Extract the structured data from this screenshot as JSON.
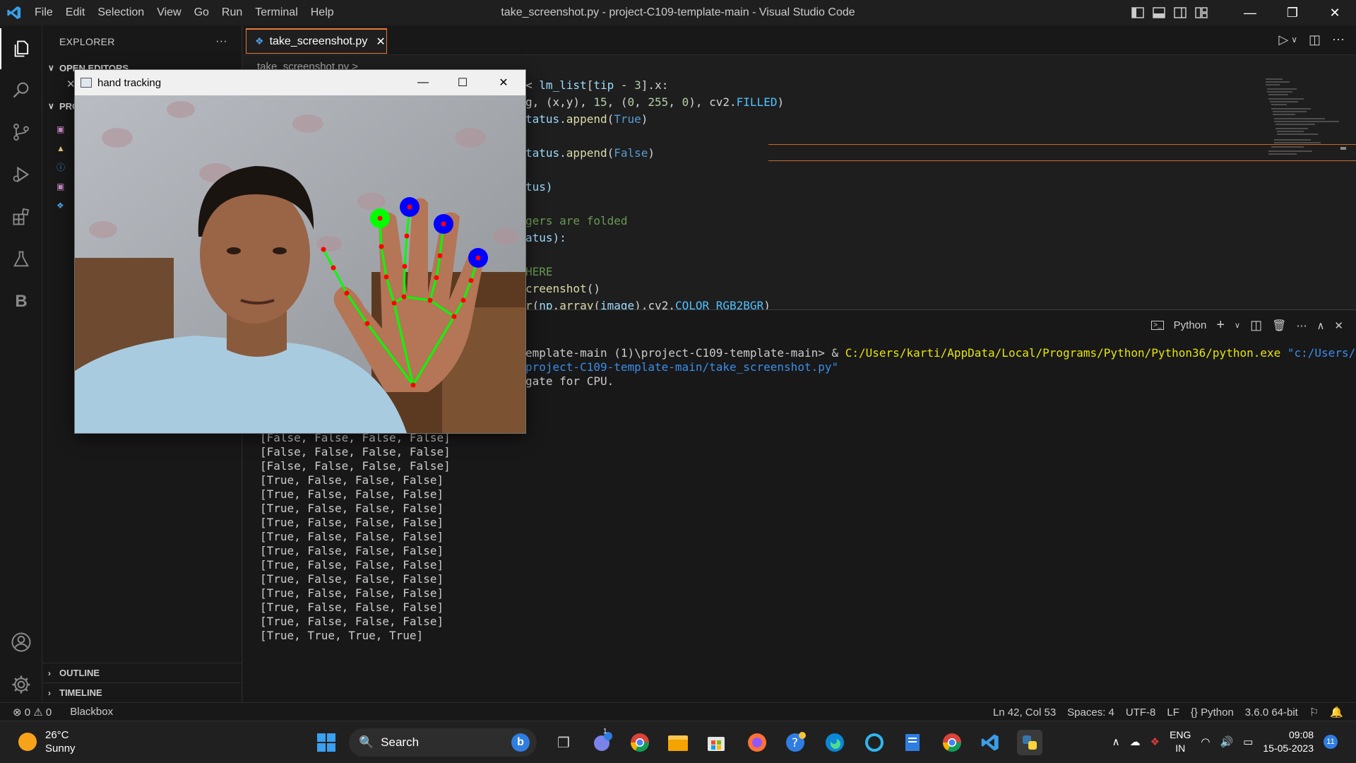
{
  "window": {
    "title": "take_screenshot.py - project-C109-template-main - Visual Studio Code",
    "menu": [
      "File",
      "Edit",
      "Selection",
      "View",
      "Go",
      "Run",
      "Terminal",
      "Help"
    ]
  },
  "sidebar": {
    "title": "EXPLORER",
    "more": "···",
    "open_editors": "OPEN EDITORS",
    "project_short": "PRO",
    "outline": "OUTLINE",
    "timeline": "TIMELINE"
  },
  "editor": {
    "tab_label": "take_screenshot.py",
    "breadcrumb": "take_screenshot.py >"
  },
  "code_lines": [
    {
      "pre": "< ",
      "a": "lm_list",
      "b": "[",
      "c": "tip",
      "d": " - ",
      "e": "3",
      "f": "].x:"
    },
    {
      "text1": "g, (x,y), ",
      "n1": "15",
      "text2": ", (",
      "n2": "0",
      "text3": ", ",
      "n3": "255",
      "text4": ", ",
      "n4": "0",
      "text5": "), cv2.",
      "const": "FILLED",
      "text6": ")"
    },
    {
      "t": "tatus.",
      "fn": "append",
      "p": "(",
      "kw": "True",
      "e": ")"
    },
    {
      "t": "tatus.",
      "fn": "append",
      "p": "(",
      "kw": "False",
      "e": ")"
    },
    {
      "t": "tus)"
    },
    {
      "cm": "gers are folded"
    },
    {
      "t": "atus):"
    },
    {
      "cm": "HERE"
    },
    {
      "fn": "creenshot",
      "t": "()"
    },
    {
      "fn": "r",
      "a": "(",
      "b": "np",
      "c": ".",
      "d": "array",
      "e": "(",
      "f": "image",
      "g": "),cv2.",
      "h": "COLOR_RGB2BGR",
      "i": ")"
    }
  ],
  "panel": {
    "shell": "Python",
    "cmd_prefix": "emplate-main (1)\\project-C109-template-main> & ",
    "cmd_exe": "C:/Users/karti/AppData/Local/Programs/Python/Python36/python.exe",
    "cmd_arg1": " \"c:/Users/karti",
    "cmd_arg2": "project-C109-template-main/take_screenshot.py\"",
    "delegate": "gate for CPU.",
    "output": [
      "[False, False, False, False]",
      "[False, False, False, False]",
      "[False, False, False, False]",
      "[True, False, False, False]",
      "[True, False, False, False]",
      "[True, False, False, False]",
      "[True, False, False, False]",
      "[True, False, False, False]",
      "[True, False, False, False]",
      "[True, False, False, False]",
      "[True, False, False, False]",
      "[True, False, False, False]",
      "[True, False, False, False]",
      "[True, False, False, False]",
      "[True, True, True, True]"
    ]
  },
  "statusbar": {
    "errors": "0",
    "warnings": "0",
    "blackbox": "Blackbox",
    "position": "Ln 42, Col 53",
    "spaces": "Spaces: 4",
    "encoding": "UTF-8",
    "eol": "LF",
    "language": "Python",
    "interpreter": "3.6.0 64-bit"
  },
  "cv_window": {
    "title": "hand tracking"
  },
  "taskbar": {
    "temperature": "26°C",
    "condition": "Sunny",
    "search": "Search",
    "lang1": "ENG",
    "lang2": "IN",
    "time": "09:08",
    "date": "15-05-2023",
    "notif": "11",
    "chat_badge": "1"
  },
  "colors": {
    "accent_tab_border": "#e8793b",
    "landmark_green": "#00ff00",
    "landmark_blue": "#0000ff",
    "landmark_red": "#ff0000"
  }
}
